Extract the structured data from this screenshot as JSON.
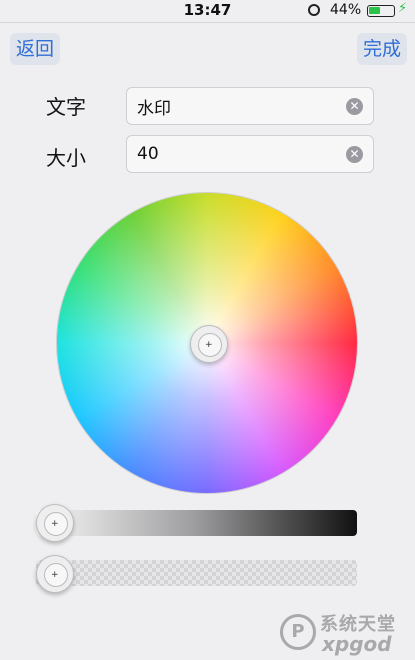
{
  "status_bar": {
    "time": "13:47",
    "battery_percent": "44%",
    "battery_level": 0.44,
    "lock_icon": "orientation-lock-icon",
    "charging_icon": "bolt-icon",
    "colors": {
      "battery": "#2bc24a"
    }
  },
  "nav": {
    "back_label": "返回",
    "done_label": "完成",
    "accent_color": "#2f6fd6"
  },
  "form": {
    "text_label": "文字",
    "text_value": "水印",
    "size_label": "大小",
    "size_value": "40",
    "clear_icon": "clear-icon"
  },
  "color_picker": {
    "wheel_knob_icon": "crosshair-icon",
    "brightness_slider_level": 0.0,
    "opacity_slider_level": 0.0
  },
  "watermark": {
    "cn": "系统天堂",
    "en": "xpgod"
  }
}
